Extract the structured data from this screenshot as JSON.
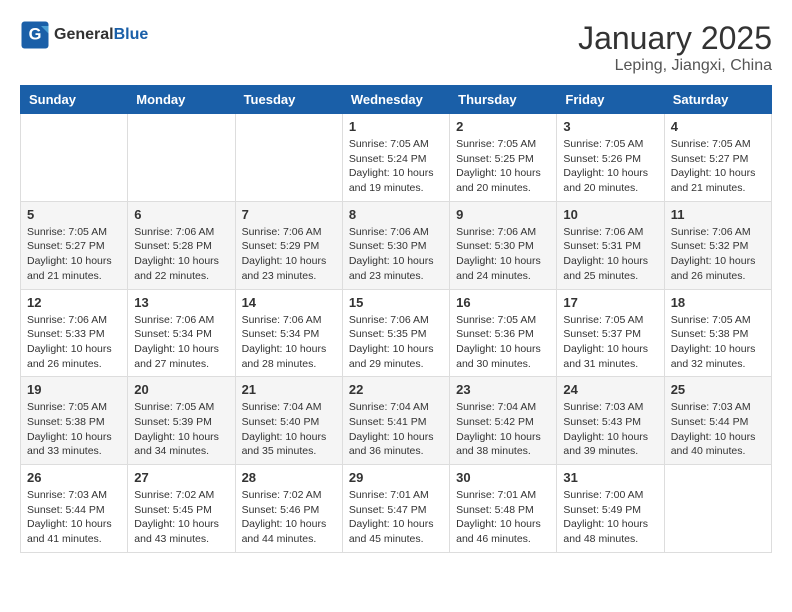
{
  "header": {
    "logo_general": "General",
    "logo_blue": "Blue",
    "title": "January 2025",
    "location": "Leping, Jiangxi, China"
  },
  "weekdays": [
    "Sunday",
    "Monday",
    "Tuesday",
    "Wednesday",
    "Thursday",
    "Friday",
    "Saturday"
  ],
  "weeks": [
    [
      {
        "day": "",
        "info": ""
      },
      {
        "day": "",
        "info": ""
      },
      {
        "day": "",
        "info": ""
      },
      {
        "day": "1",
        "info": "Sunrise: 7:05 AM\nSunset: 5:24 PM\nDaylight: 10 hours\nand 19 minutes."
      },
      {
        "day": "2",
        "info": "Sunrise: 7:05 AM\nSunset: 5:25 PM\nDaylight: 10 hours\nand 20 minutes."
      },
      {
        "day": "3",
        "info": "Sunrise: 7:05 AM\nSunset: 5:26 PM\nDaylight: 10 hours\nand 20 minutes."
      },
      {
        "day": "4",
        "info": "Sunrise: 7:05 AM\nSunset: 5:27 PM\nDaylight: 10 hours\nand 21 minutes."
      }
    ],
    [
      {
        "day": "5",
        "info": "Sunrise: 7:05 AM\nSunset: 5:27 PM\nDaylight: 10 hours\nand 21 minutes."
      },
      {
        "day": "6",
        "info": "Sunrise: 7:06 AM\nSunset: 5:28 PM\nDaylight: 10 hours\nand 22 minutes."
      },
      {
        "day": "7",
        "info": "Sunrise: 7:06 AM\nSunset: 5:29 PM\nDaylight: 10 hours\nand 23 minutes."
      },
      {
        "day": "8",
        "info": "Sunrise: 7:06 AM\nSunset: 5:30 PM\nDaylight: 10 hours\nand 23 minutes."
      },
      {
        "day": "9",
        "info": "Sunrise: 7:06 AM\nSunset: 5:30 PM\nDaylight: 10 hours\nand 24 minutes."
      },
      {
        "day": "10",
        "info": "Sunrise: 7:06 AM\nSunset: 5:31 PM\nDaylight: 10 hours\nand 25 minutes."
      },
      {
        "day": "11",
        "info": "Sunrise: 7:06 AM\nSunset: 5:32 PM\nDaylight: 10 hours\nand 26 minutes."
      }
    ],
    [
      {
        "day": "12",
        "info": "Sunrise: 7:06 AM\nSunset: 5:33 PM\nDaylight: 10 hours\nand 26 minutes."
      },
      {
        "day": "13",
        "info": "Sunrise: 7:06 AM\nSunset: 5:34 PM\nDaylight: 10 hours\nand 27 minutes."
      },
      {
        "day": "14",
        "info": "Sunrise: 7:06 AM\nSunset: 5:34 PM\nDaylight: 10 hours\nand 28 minutes."
      },
      {
        "day": "15",
        "info": "Sunrise: 7:06 AM\nSunset: 5:35 PM\nDaylight: 10 hours\nand 29 minutes."
      },
      {
        "day": "16",
        "info": "Sunrise: 7:05 AM\nSunset: 5:36 PM\nDaylight: 10 hours\nand 30 minutes."
      },
      {
        "day": "17",
        "info": "Sunrise: 7:05 AM\nSunset: 5:37 PM\nDaylight: 10 hours\nand 31 minutes."
      },
      {
        "day": "18",
        "info": "Sunrise: 7:05 AM\nSunset: 5:38 PM\nDaylight: 10 hours\nand 32 minutes."
      }
    ],
    [
      {
        "day": "19",
        "info": "Sunrise: 7:05 AM\nSunset: 5:38 PM\nDaylight: 10 hours\nand 33 minutes."
      },
      {
        "day": "20",
        "info": "Sunrise: 7:05 AM\nSunset: 5:39 PM\nDaylight: 10 hours\nand 34 minutes."
      },
      {
        "day": "21",
        "info": "Sunrise: 7:04 AM\nSunset: 5:40 PM\nDaylight: 10 hours\nand 35 minutes."
      },
      {
        "day": "22",
        "info": "Sunrise: 7:04 AM\nSunset: 5:41 PM\nDaylight: 10 hours\nand 36 minutes."
      },
      {
        "day": "23",
        "info": "Sunrise: 7:04 AM\nSunset: 5:42 PM\nDaylight: 10 hours\nand 38 minutes."
      },
      {
        "day": "24",
        "info": "Sunrise: 7:03 AM\nSunset: 5:43 PM\nDaylight: 10 hours\nand 39 minutes."
      },
      {
        "day": "25",
        "info": "Sunrise: 7:03 AM\nSunset: 5:44 PM\nDaylight: 10 hours\nand 40 minutes."
      }
    ],
    [
      {
        "day": "26",
        "info": "Sunrise: 7:03 AM\nSunset: 5:44 PM\nDaylight: 10 hours\nand 41 minutes."
      },
      {
        "day": "27",
        "info": "Sunrise: 7:02 AM\nSunset: 5:45 PM\nDaylight: 10 hours\nand 43 minutes."
      },
      {
        "day": "28",
        "info": "Sunrise: 7:02 AM\nSunset: 5:46 PM\nDaylight: 10 hours\nand 44 minutes."
      },
      {
        "day": "29",
        "info": "Sunrise: 7:01 AM\nSunset: 5:47 PM\nDaylight: 10 hours\nand 45 minutes."
      },
      {
        "day": "30",
        "info": "Sunrise: 7:01 AM\nSunset: 5:48 PM\nDaylight: 10 hours\nand 46 minutes."
      },
      {
        "day": "31",
        "info": "Sunrise: 7:00 AM\nSunset: 5:49 PM\nDaylight: 10 hours\nand 48 minutes."
      },
      {
        "day": "",
        "info": ""
      }
    ]
  ]
}
